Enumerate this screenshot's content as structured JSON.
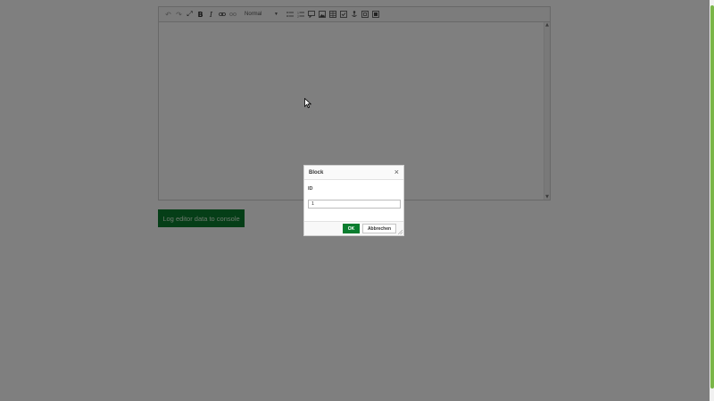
{
  "toolbar": {
    "undo_icon": "undo-icon",
    "redo_icon": "redo-icon",
    "maximize_icon": "maximize-icon",
    "bold_label": "B",
    "italic_label": "I",
    "link_icon": "link-icon",
    "unlink_icon": "unlink-icon",
    "format_label": "Normal",
    "bulleted_list_icon": "bulleted-list-icon",
    "numbered_list_icon": "numbered-list-icon",
    "comment_icon": "comment-icon",
    "image_icon": "image-icon",
    "table_icon": "table-icon",
    "checkbox_icon": "checkbox-icon",
    "anchor_icon": "anchor-icon",
    "block_icon": "block-icon",
    "widget_icon": "widget-icon"
  },
  "log_button": {
    "label": "Log editor data to console"
  },
  "dialog": {
    "title": "Block",
    "close_label": "×",
    "id_label": "ID",
    "id_value": "1",
    "ok_label": "OK",
    "cancel_label": "Abbrechen"
  },
  "colors": {
    "accent_green": "#0a7d2f",
    "scroll_thumb": "#7ab648",
    "overlay": "rgba(0,0,0,0.5)"
  }
}
